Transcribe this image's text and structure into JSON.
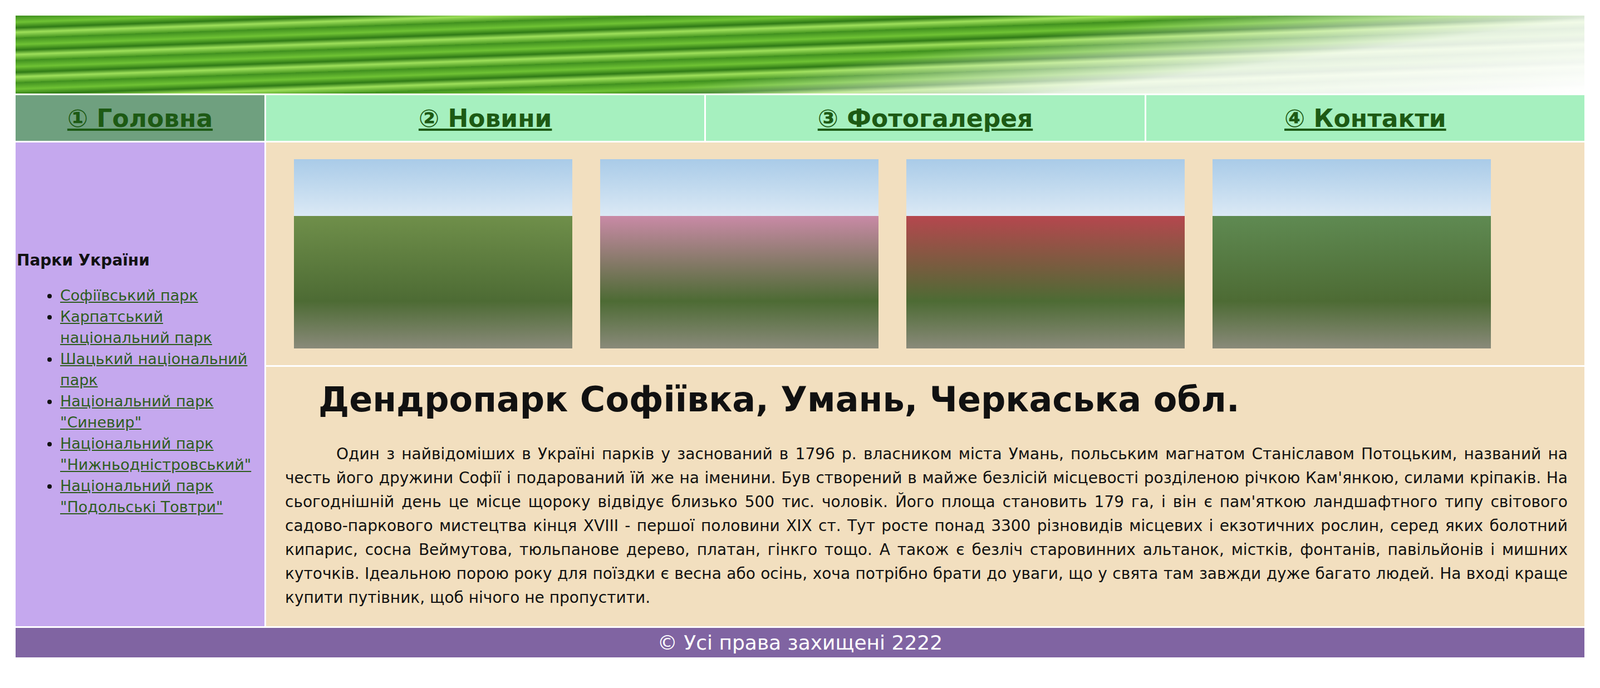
{
  "nav": [
    {
      "label": "① Головна",
      "selected": true
    },
    {
      "label": "② Новини",
      "selected": false
    },
    {
      "label": "③ Фотогалерея",
      "selected": false
    },
    {
      "label": "④ Контакти",
      "selected": false
    }
  ],
  "sidebar": {
    "title": "Парки України",
    "items": [
      "Софіївський парк",
      "Карпатський національний парк",
      "Шацький національний парк",
      "Національний парк \"Синевир\"",
      "Національний парк \"Нижньодністровський\"",
      "Національний парк \"Подольські Товтри\""
    ]
  },
  "photos": [
    {
      "color": "#6f8f4a"
    },
    {
      "color": "#c98aa6"
    },
    {
      "color": "#b5474e"
    },
    {
      "color": "#5f8a52"
    }
  ],
  "article": {
    "title": "Дендропарк Софіївка, Умань, Черкаська обл.",
    "text": "Один з найвідоміших в Україні парків у заснований в 1796 р. власником міста Умань, польським магнатом Станіславом Потоцьким, названий на честь його дружини Софії і подарований їй же на іменини. Був створений в майже безлісій місцевості розділеною річкою Кам'янкою, силами кріпаків. На сьогоднішній день це місце щороку відвідує близько 500 тис. чоловік. Його площа становить 179 га, і він є пам'яткою ландшафтного типу світового садово-паркового мистецтва кінця XVIII - першої половини XIX ст. Тут росте понад 3300 різновидів місцевих і екзотичних рослин, серед яких болотний кипарис, сосна Веймутова, тюльпанове дерево, платан, гінкго тощо. А також є безліч старовинних альтанок, містків, фонтанів, павільйонів і мишних куточків. Ідеальною порою року для поїздки є весна або осінь, хоча потрібно брати до уваги, що у свята там завжди дуже багато людей. На вході краще купити путівник, щоб нічого не пропустити."
  },
  "footer": "© Усі права захищені 2222"
}
